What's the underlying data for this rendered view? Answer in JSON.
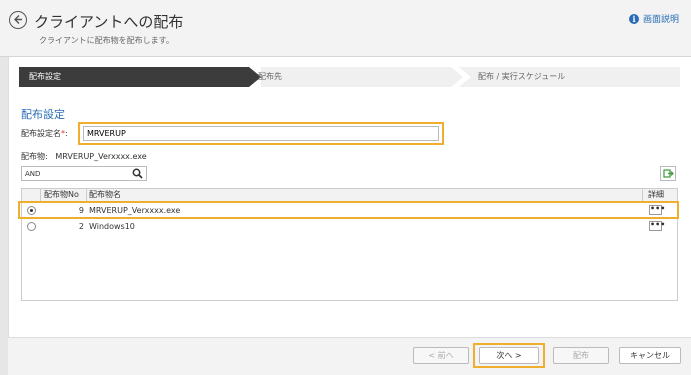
{
  "header": {
    "title": "クライアントへの配布",
    "subtitle": "クライアントに配布物を配布します。",
    "help_label": "画面説明",
    "help_icon": "info-icon"
  },
  "steps": [
    {
      "label": "配布設定",
      "active": true
    },
    {
      "label": "配布先",
      "active": false
    },
    {
      "label": "配布 / 実行スケジュール",
      "active": false
    }
  ],
  "form": {
    "section_title": "配布設定",
    "name_label": "配布設定名",
    "required_mark": "*",
    "name_separator": ":",
    "name_value": "MRVERUP",
    "item_label": "配布物:",
    "item_value": "MRVERUP_Verxxxx.exe"
  },
  "filter": {
    "value": "AND",
    "search_icon": "search-icon",
    "export_icon": "export-icon"
  },
  "table": {
    "columns": [
      "配布物No",
      "配布物名",
      "詳細"
    ],
    "rows": [
      {
        "selected": true,
        "no": "9",
        "name": "MRVERUP_Verxxxx.exe",
        "detail": "•••"
      },
      {
        "selected": false,
        "no": "2",
        "name": "Windows10",
        "detail": "•••"
      }
    ]
  },
  "footer": {
    "prev_label": "< 前へ",
    "next_label": "次へ >",
    "distribute_label": "配布",
    "cancel_label": "キャンセル"
  },
  "colors": {
    "accent": "#2a6db5",
    "highlight": "#f0ae2f",
    "active_step": "#3c3c3c"
  }
}
